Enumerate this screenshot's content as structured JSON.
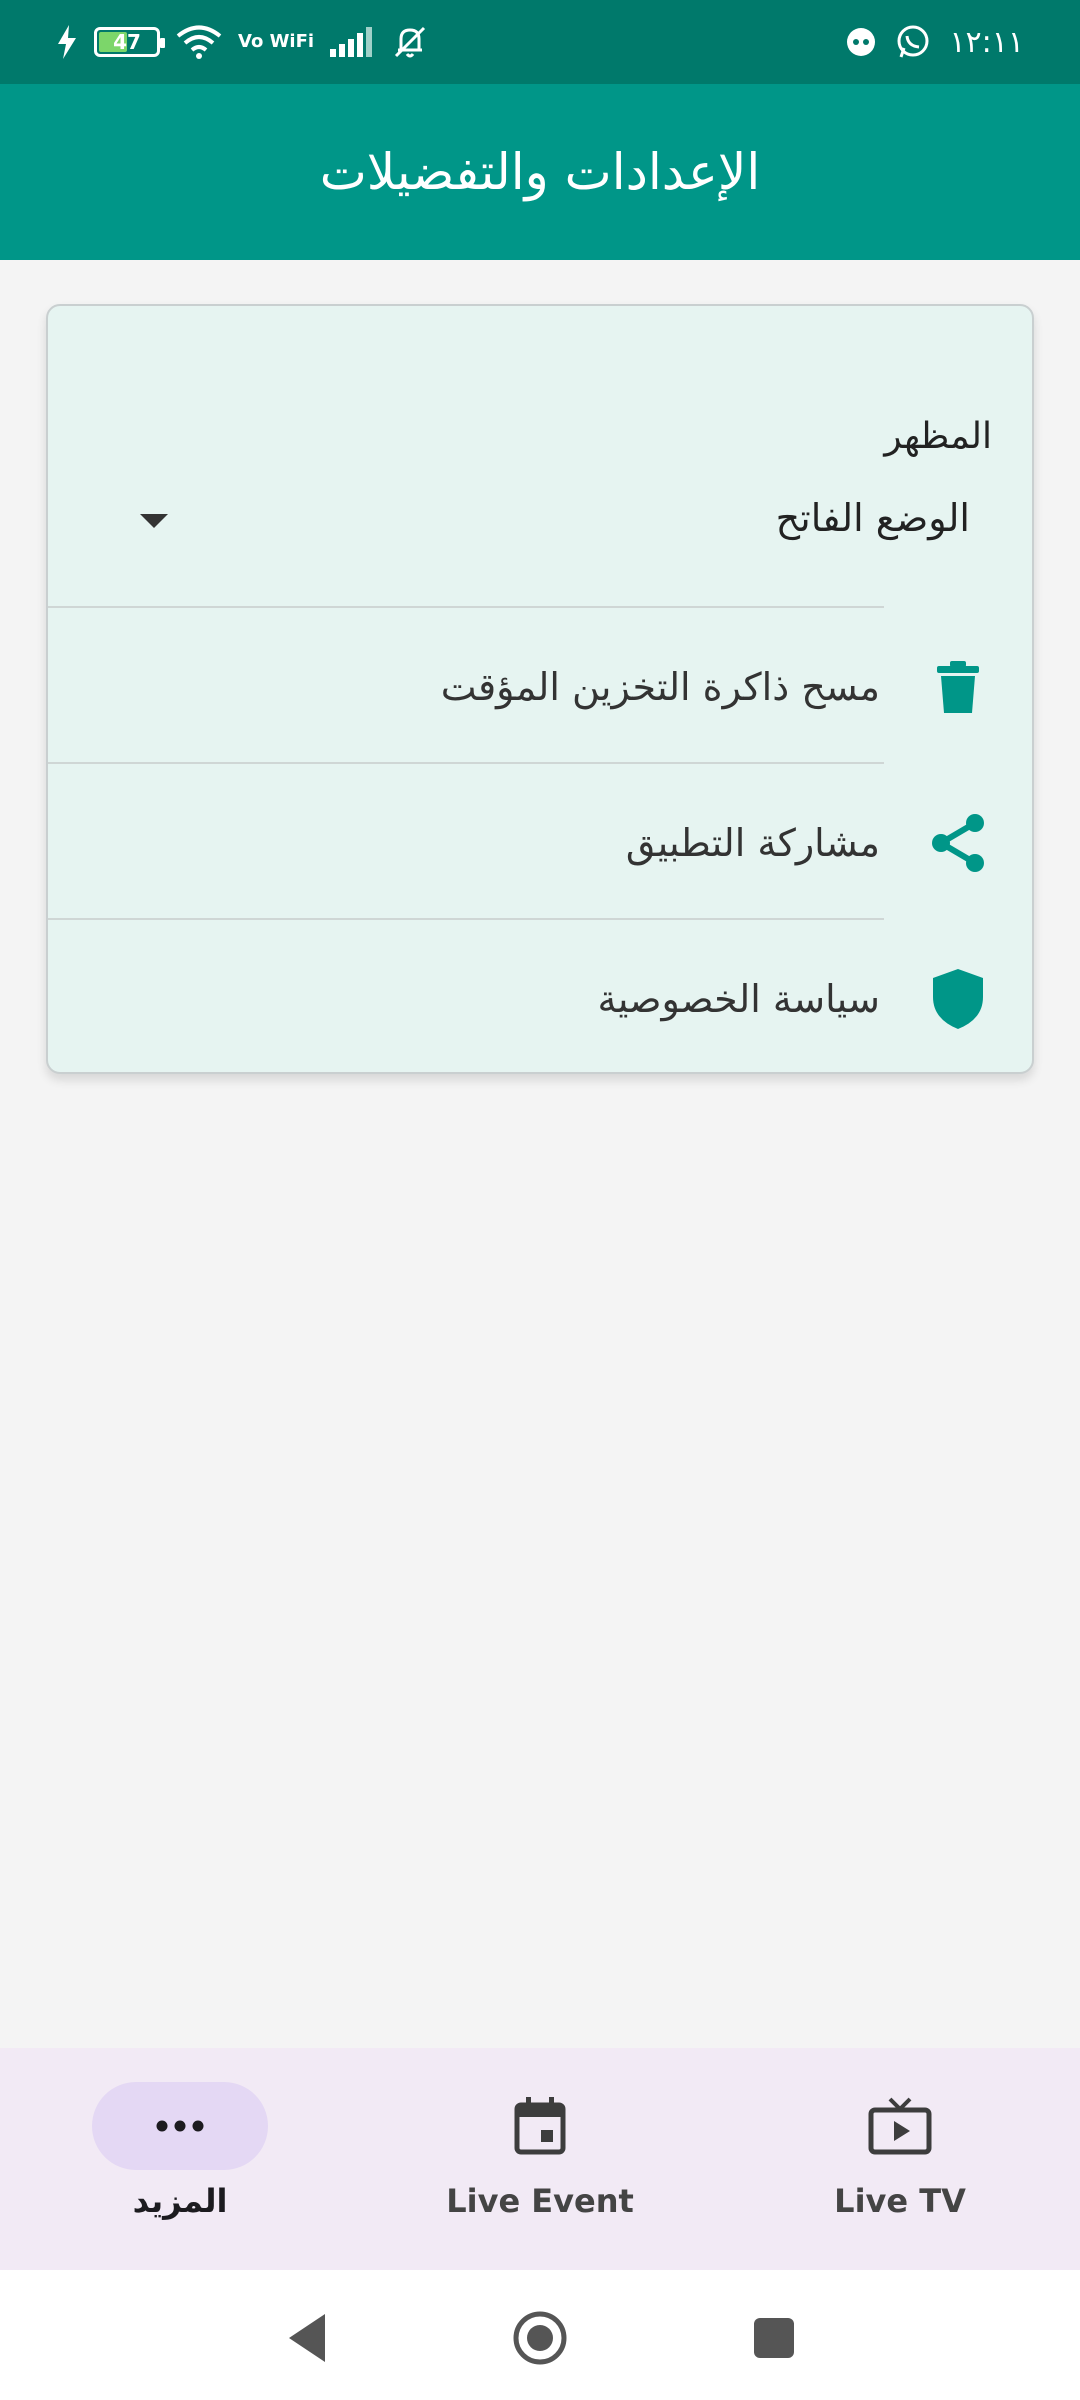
{
  "status_bar": {
    "battery_level": "47",
    "network_label": "Vo WiFi",
    "time": "١٢:١١"
  },
  "app_bar": {
    "title": "الإعدادات والتفضيلات"
  },
  "settings": {
    "appearance_label": "المظهر",
    "theme_value": "الوضع الفاتح",
    "items": [
      {
        "label": "مسح ذاكرة التخزين المؤقت",
        "icon": "trash-icon"
      },
      {
        "label": "مشاركة التطبيق",
        "icon": "share-icon"
      },
      {
        "label": "سياسة الخصوصية",
        "icon": "shield-icon"
      }
    ]
  },
  "bottom_nav": {
    "items": [
      {
        "label": "Live TV",
        "icon": "tv-icon",
        "active": false
      },
      {
        "label": "Live Event",
        "icon": "calendar-icon",
        "active": false
      },
      {
        "label": "المزيد",
        "icon": "more-icon",
        "active": true
      }
    ]
  },
  "colors": {
    "status_bar": "#00796b",
    "app_bar": "#009688",
    "accent": "#009688",
    "card_bg": "#e6f4f1",
    "nav_bg": "#f2eaf5",
    "nav_active_pill": "#e4d8f4"
  }
}
